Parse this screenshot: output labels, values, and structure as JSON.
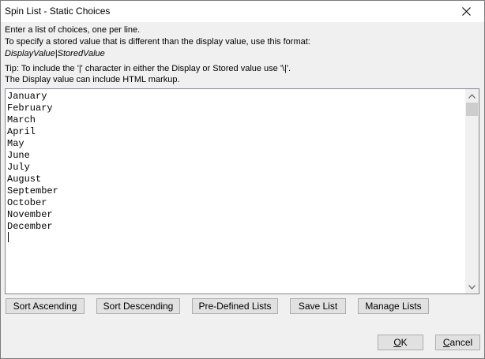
{
  "window": {
    "title": "Spin List - Static Choices",
    "close_glyph": "✕"
  },
  "instructions": {
    "line1": "Enter a list of choices, one per line.",
    "line2": "To specify a stored value that is different than the display value, use this format:",
    "line3": "DisplayValue|StoredValue",
    "line4": "Tip: To include the '|' character in either the Display or Stored value use '\\|'.",
    "line5": "The Display value can include HTML markup."
  },
  "choices": [
    "January",
    "February",
    "March",
    "April",
    "May",
    "June",
    "July",
    "August",
    "September",
    "October",
    "November",
    "December"
  ],
  "buttons": {
    "sort_ascending": "Sort Ascending",
    "sort_descending": "Sort Descending",
    "predefined_lists": "Pre-Defined Lists",
    "save_list": "Save List",
    "manage_lists": "Manage Lists",
    "ok": {
      "accel": "O",
      "rest": "K"
    },
    "cancel": {
      "accel": "C",
      "rest": "ancel"
    }
  },
  "icons": {
    "close": "close-icon",
    "scroll_up": "chevron-up-icon",
    "scroll_down": "chevron-down-icon"
  }
}
